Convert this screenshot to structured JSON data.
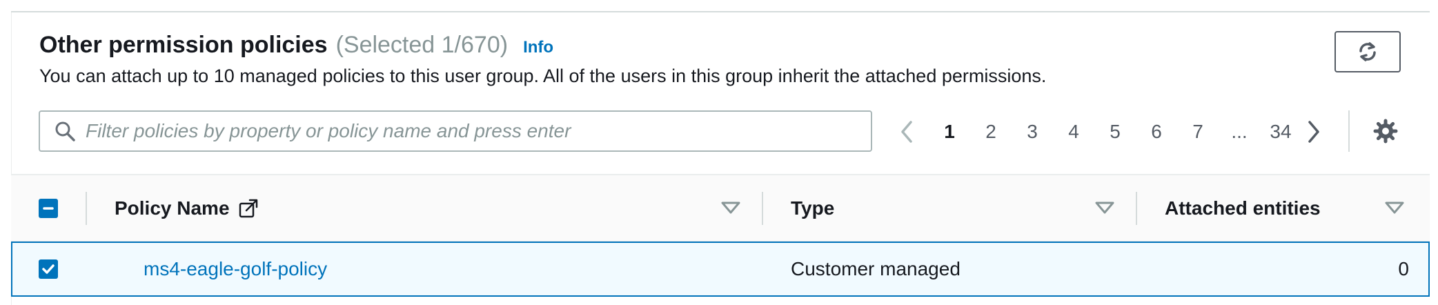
{
  "header": {
    "title": "Other permission policies",
    "count": "(Selected 1/670)",
    "info_label": "Info",
    "description": "You can attach up to 10 managed policies to this user group. All of the users in this group inherit the attached permissions."
  },
  "search": {
    "placeholder": "Filter policies by property or policy name and press enter",
    "value": ""
  },
  "pagination": {
    "current": "1",
    "pages": [
      "1",
      "2",
      "3",
      "4",
      "5",
      "6",
      "7",
      "...",
      "34"
    ]
  },
  "table": {
    "columns": {
      "policy_name": "Policy Name",
      "type": "Type",
      "attached_entities": "Attached entities"
    },
    "rows": [
      {
        "policy_name": "ms4-eagle-golf-policy",
        "type": "Customer managed",
        "attached_entities": "0",
        "selected": true
      }
    ]
  },
  "icons": {
    "refresh": "refresh-icon",
    "search": "search-icon",
    "prev": "chevron-left-icon",
    "next": "chevron-right-icon",
    "settings": "gear-icon",
    "external": "external-link-icon",
    "sort": "sort-caret-icon"
  },
  "colors": {
    "link": "#0073bb",
    "selected_row_bg": "#f1faff",
    "muted": "#879596"
  }
}
